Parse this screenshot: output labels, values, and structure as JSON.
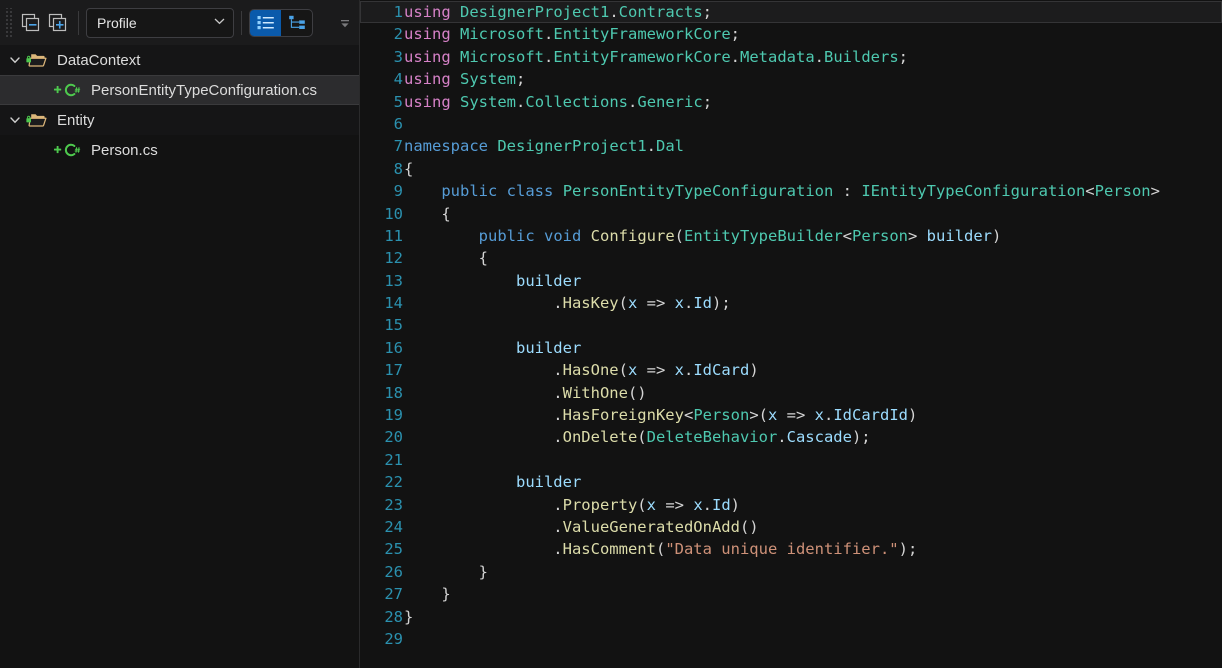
{
  "window": {
    "title": "Solution Explorer",
    "background": "#121212"
  },
  "colors": {
    "accent": "#0a5aab",
    "keyword": "#569cd6",
    "using_keyword": "#d782c8",
    "type": "#4ec9b0",
    "method": "#dcdcaa",
    "variable": "#9cdcfe",
    "string": "#ce9178",
    "line_number": "#2b91af",
    "punctuation": "#d4d4d4",
    "folder_icon": "#dcb67a",
    "lock_badge": "#4ec94e",
    "csharp_icon": "#4ec94e",
    "panel_bg": "#121212",
    "toolbar_bg": "#1b1b1c",
    "selected_row_bg": "#2c2c2e"
  },
  "toolbar": {
    "collapse_all_tooltip": "Collapse All",
    "expand_all_tooltip": "Expand All",
    "profile": {
      "label": "Profile",
      "placeholder": "Profile",
      "options": [
        "Profile"
      ]
    },
    "views": [
      {
        "name": "list-view",
        "label": "List View",
        "active": true
      },
      {
        "name": "tree-view",
        "label": "Tree View",
        "active": false
      }
    ],
    "overflow_label": "More"
  },
  "tree": {
    "items": [
      {
        "label": "DataContext",
        "kind": "folder",
        "expanded": true,
        "locked": true,
        "depth": 0,
        "selected": false
      },
      {
        "label": "PersonEntityTypeConfiguration.cs",
        "kind": "csharp",
        "added": true,
        "depth": 1,
        "selected": true
      },
      {
        "label": "Entity",
        "kind": "folder",
        "expanded": true,
        "locked": true,
        "depth": 0,
        "selected": false
      },
      {
        "label": "Person.cs",
        "kind": "csharp",
        "added": true,
        "depth": 1,
        "selected": false
      }
    ]
  },
  "editor": {
    "language": "csharp",
    "current_line": 1,
    "total_lines": 29,
    "lines": [
      {
        "n": 1,
        "current": true,
        "tokens": [
          [
            "kp",
            "using"
          ],
          [
            "p",
            " "
          ],
          [
            "t",
            "DesignerProject1"
          ],
          [
            "p",
            "."
          ],
          [
            "t",
            "Contracts"
          ],
          [
            "p",
            ";"
          ]
        ]
      },
      {
        "n": 2,
        "current": false,
        "tokens": [
          [
            "kp",
            "using"
          ],
          [
            "p",
            " "
          ],
          [
            "t",
            "Microsoft"
          ],
          [
            "p",
            "."
          ],
          [
            "t",
            "EntityFrameworkCore"
          ],
          [
            "p",
            ";"
          ]
        ]
      },
      {
        "n": 3,
        "current": false,
        "tokens": [
          [
            "kp",
            "using"
          ],
          [
            "p",
            " "
          ],
          [
            "t",
            "Microsoft"
          ],
          [
            "p",
            "."
          ],
          [
            "t",
            "EntityFrameworkCore"
          ],
          [
            "p",
            "."
          ],
          [
            "t",
            "Metadata"
          ],
          [
            "p",
            "."
          ],
          [
            "t",
            "Builders"
          ],
          [
            "p",
            ";"
          ]
        ]
      },
      {
        "n": 4,
        "current": false,
        "tokens": [
          [
            "kp",
            "using"
          ],
          [
            "p",
            " "
          ],
          [
            "t",
            "System"
          ],
          [
            "p",
            ";"
          ]
        ]
      },
      {
        "n": 5,
        "current": false,
        "tokens": [
          [
            "kp",
            "using"
          ],
          [
            "p",
            " "
          ],
          [
            "t",
            "System"
          ],
          [
            "p",
            "."
          ],
          [
            "t",
            "Collections"
          ],
          [
            "p",
            "."
          ],
          [
            "t",
            "Generic"
          ],
          [
            "p",
            ";"
          ]
        ]
      },
      {
        "n": 6,
        "current": false,
        "tokens": []
      },
      {
        "n": 7,
        "current": false,
        "tokens": [
          [
            "k",
            "namespace"
          ],
          [
            "p",
            " "
          ],
          [
            "t",
            "DesignerProject1"
          ],
          [
            "p",
            "."
          ],
          [
            "t",
            "Dal"
          ]
        ]
      },
      {
        "n": 8,
        "current": false,
        "tokens": [
          [
            "p",
            "{"
          ]
        ]
      },
      {
        "n": 9,
        "current": false,
        "tokens": [
          [
            "p",
            "    "
          ],
          [
            "k",
            "public"
          ],
          [
            "p",
            " "
          ],
          [
            "k",
            "class"
          ],
          [
            "p",
            " "
          ],
          [
            "t",
            "PersonEntityTypeConfiguration"
          ],
          [
            "p",
            " : "
          ],
          [
            "t",
            "IEntityTypeConfiguration"
          ],
          [
            "p",
            "<"
          ],
          [
            "t",
            "Person"
          ],
          [
            "p",
            ">"
          ]
        ]
      },
      {
        "n": 10,
        "current": false,
        "tokens": [
          [
            "p",
            "    {"
          ]
        ]
      },
      {
        "n": 11,
        "current": false,
        "tokens": [
          [
            "p",
            "        "
          ],
          [
            "k",
            "public"
          ],
          [
            "p",
            " "
          ],
          [
            "k",
            "void"
          ],
          [
            "p",
            " "
          ],
          [
            "m",
            "Configure"
          ],
          [
            "p",
            "("
          ],
          [
            "t",
            "EntityTypeBuilder"
          ],
          [
            "p",
            "<"
          ],
          [
            "t",
            "Person"
          ],
          [
            "p",
            "> "
          ],
          [
            "v",
            "builder"
          ],
          [
            "p",
            ")"
          ]
        ]
      },
      {
        "n": 12,
        "current": false,
        "tokens": [
          [
            "p",
            "        {"
          ]
        ]
      },
      {
        "n": 13,
        "current": false,
        "tokens": [
          [
            "p",
            "            "
          ],
          [
            "v",
            "builder"
          ]
        ]
      },
      {
        "n": 14,
        "current": false,
        "tokens": [
          [
            "p",
            "                ."
          ],
          [
            "m",
            "HasKey"
          ],
          [
            "p",
            "("
          ],
          [
            "v",
            "x"
          ],
          [
            "p",
            " => "
          ],
          [
            "v",
            "x"
          ],
          [
            "p",
            "."
          ],
          [
            "v",
            "Id"
          ],
          [
            "p",
            ");"
          ]
        ]
      },
      {
        "n": 15,
        "current": false,
        "tokens": []
      },
      {
        "n": 16,
        "current": false,
        "tokens": [
          [
            "p",
            "            "
          ],
          [
            "v",
            "builder"
          ]
        ]
      },
      {
        "n": 17,
        "current": false,
        "tokens": [
          [
            "p",
            "                ."
          ],
          [
            "m",
            "HasOne"
          ],
          [
            "p",
            "("
          ],
          [
            "v",
            "x"
          ],
          [
            "p",
            " => "
          ],
          [
            "v",
            "x"
          ],
          [
            "p",
            "."
          ],
          [
            "v",
            "IdCard"
          ],
          [
            "p",
            ")"
          ]
        ]
      },
      {
        "n": 18,
        "current": false,
        "tokens": [
          [
            "p",
            "                ."
          ],
          [
            "m",
            "WithOne"
          ],
          [
            "p",
            "()"
          ]
        ]
      },
      {
        "n": 19,
        "current": false,
        "tokens": [
          [
            "p",
            "                ."
          ],
          [
            "m",
            "HasForeignKey"
          ],
          [
            "p",
            "<"
          ],
          [
            "t",
            "Person"
          ],
          [
            "p",
            ">("
          ],
          [
            "v",
            "x"
          ],
          [
            "p",
            " => "
          ],
          [
            "v",
            "x"
          ],
          [
            "p",
            "."
          ],
          [
            "v",
            "IdCardId"
          ],
          [
            "p",
            ")"
          ]
        ]
      },
      {
        "n": 20,
        "current": false,
        "tokens": [
          [
            "p",
            "                ."
          ],
          [
            "m",
            "OnDelete"
          ],
          [
            "p",
            "("
          ],
          [
            "t",
            "DeleteBehavior"
          ],
          [
            "p",
            "."
          ],
          [
            "v",
            "Cascade"
          ],
          [
            "p",
            ");"
          ]
        ]
      },
      {
        "n": 21,
        "current": false,
        "tokens": []
      },
      {
        "n": 22,
        "current": false,
        "tokens": [
          [
            "p",
            "            "
          ],
          [
            "v",
            "builder"
          ]
        ]
      },
      {
        "n": 23,
        "current": false,
        "tokens": [
          [
            "p",
            "                ."
          ],
          [
            "m",
            "Property"
          ],
          [
            "p",
            "("
          ],
          [
            "v",
            "x"
          ],
          [
            "p",
            " => "
          ],
          [
            "v",
            "x"
          ],
          [
            "p",
            "."
          ],
          [
            "v",
            "Id"
          ],
          [
            "p",
            ")"
          ]
        ]
      },
      {
        "n": 24,
        "current": false,
        "tokens": [
          [
            "p",
            "                ."
          ],
          [
            "m",
            "ValueGeneratedOnAdd"
          ],
          [
            "p",
            "()"
          ]
        ]
      },
      {
        "n": 25,
        "current": false,
        "tokens": [
          [
            "p",
            "                ."
          ],
          [
            "m",
            "HasComment"
          ],
          [
            "p",
            "("
          ],
          [
            "s",
            "\"Data unique identifier.\""
          ],
          [
            "p",
            ");"
          ]
        ]
      },
      {
        "n": 26,
        "current": false,
        "tokens": [
          [
            "p",
            "        }"
          ]
        ]
      },
      {
        "n": 27,
        "current": false,
        "tokens": [
          [
            "p",
            "    }"
          ]
        ]
      },
      {
        "n": 28,
        "current": false,
        "tokens": [
          [
            "p",
            "}"
          ]
        ]
      },
      {
        "n": 29,
        "current": false,
        "tokens": []
      }
    ]
  }
}
